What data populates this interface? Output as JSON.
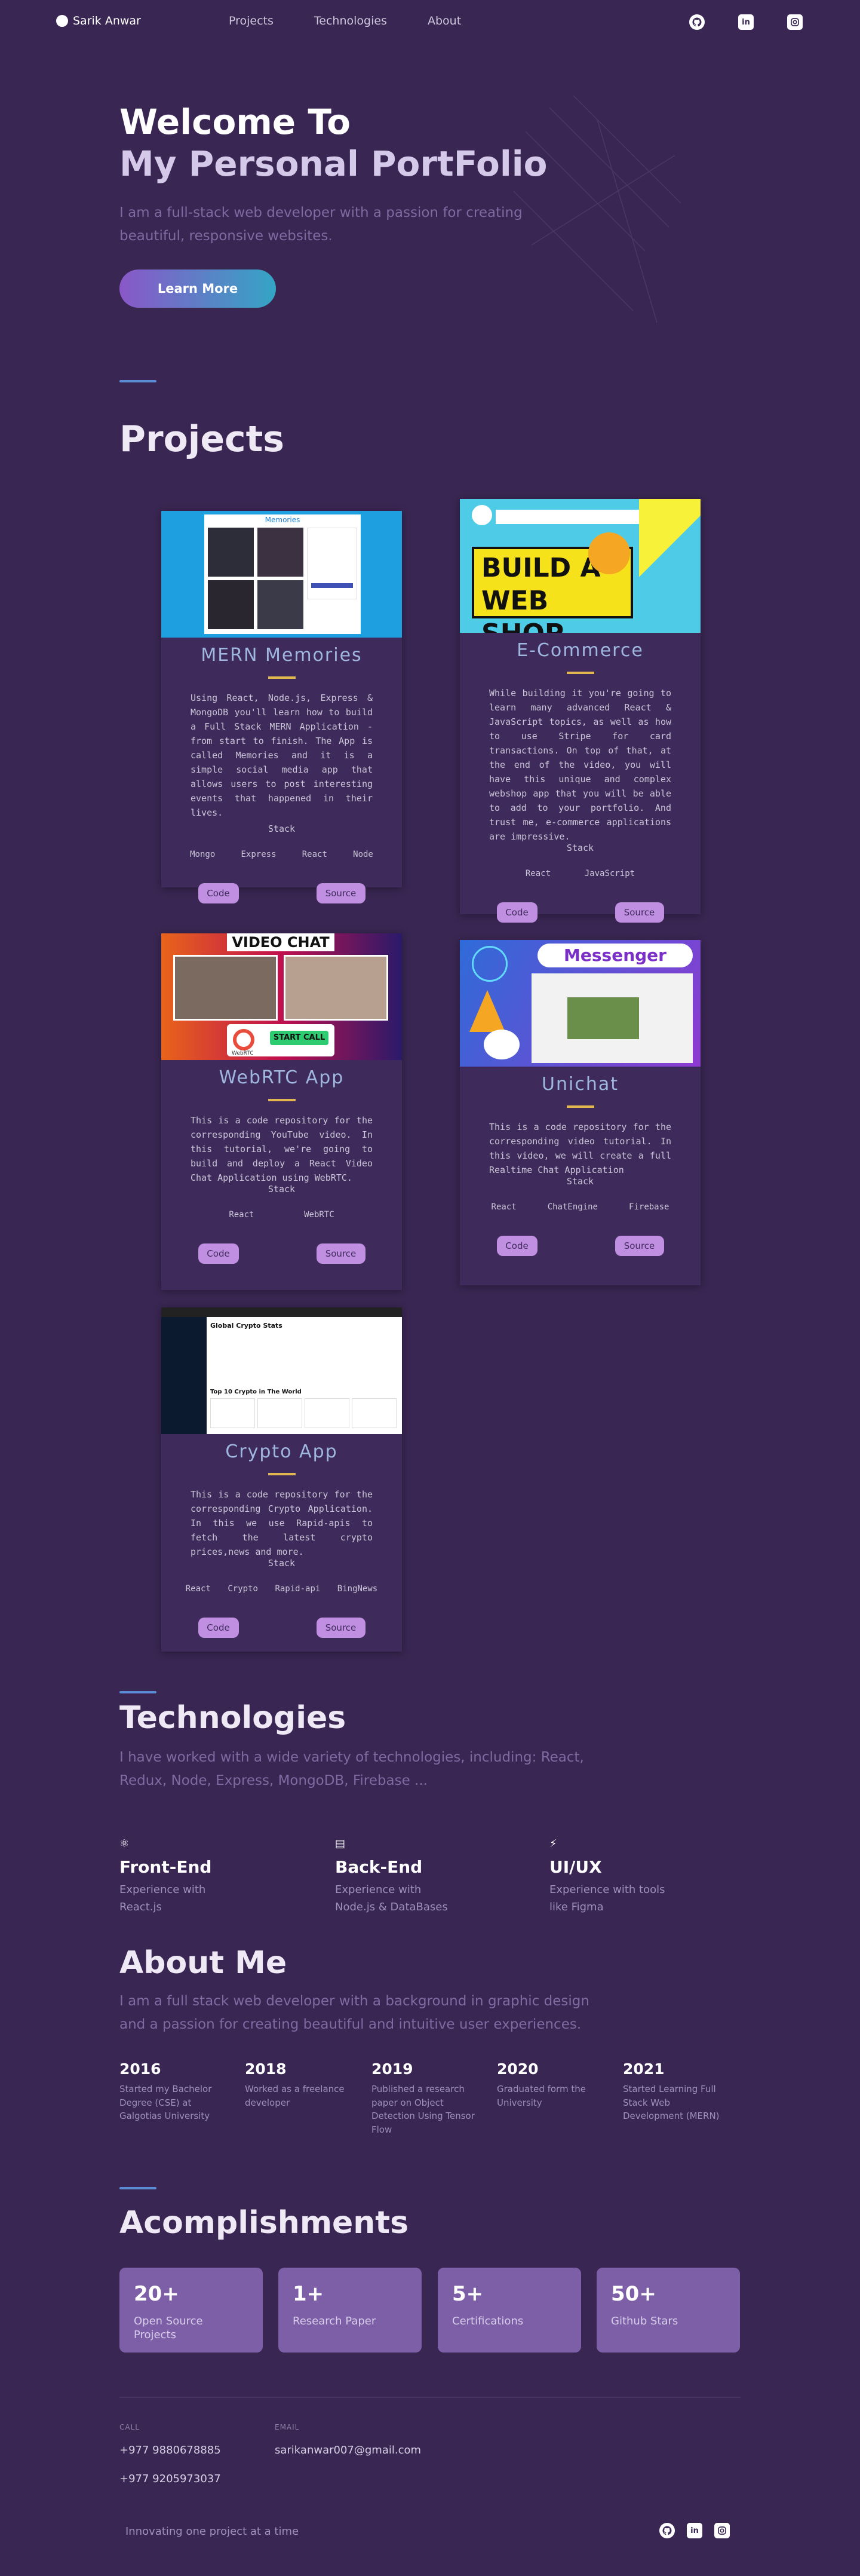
{
  "nav": {
    "brand": "Sarik Anwar",
    "links": [
      "Projects",
      "Technologies",
      "About"
    ],
    "social": [
      "github-icon",
      "linkedin-icon",
      "instagram-icon"
    ]
  },
  "hero": {
    "title_line1": "Welcome To",
    "title_line2": "My Personal PortFolio",
    "description": "I am a full-stack web developer with a passion for creating beautiful, responsive websites.",
    "button": "Learn More"
  },
  "projects": {
    "title": "Projects",
    "items": [
      {
        "title": "MERN Memories",
        "image_caption": "Memories",
        "description": "Using React, Node.js, Express & MongoDB you'll learn how to build a Full Stack MERN Application - from start to finish. The App is called Memories and it is a simple social media app that allows users to post interesting events that happened in their lives.",
        "stack_label": "Stack",
        "tags": [
          "Mongo",
          "Express",
          "React",
          "Node"
        ],
        "code": "Code",
        "source": "Source"
      },
      {
        "title": "E-Commerce",
        "image_caption_1": "BUILD A",
        "image_caption_2": "WEB SHOP",
        "description": "While building it you're going to learn many advanced React & JavaScript topics, as well as how to use Stripe for card transactions. On top of that, at the end of the video, you will have this unique and complex webshop app that you will be able to add to your portfolio. And trust me, e-commerce applications are impressive.",
        "stack_label": "Stack",
        "tags": [
          "React",
          "JavaScript"
        ],
        "code": "Code",
        "source": "Source"
      },
      {
        "title": "WebRTC App",
        "image_caption_1": "VIDEO CHAT",
        "image_caption_2": "START CALL",
        "image_caption_3": "WebRTC",
        "description": "This is a code repository for the corresponding YouTube video. In this tutorial, we're going to build and deploy a React Video Chat Application using WebRTC.",
        "stack_label": "Stack",
        "tags": [
          "React",
          "WebRTC"
        ],
        "code": "Code",
        "source": "Source"
      },
      {
        "title": "Unichat",
        "image_caption": "Messenger",
        "description": "This is a code repository for the corresponding video tutorial. In this video, we will create a full Realtime Chat Application",
        "stack_label": "Stack",
        "tags": [
          "React",
          "ChatEngine",
          "Firebase"
        ],
        "code": "Code",
        "source": "Source"
      },
      {
        "title": "Crypto App",
        "image_caption_1": "Global Crypto Stats",
        "image_caption_2": "Top 10 Crypto in The World",
        "description": "This is a code repository for the corresponding Crypto Application. In this we use Rapid-apis to fetch the latest crypto prices,news and more.",
        "stack_label": "Stack",
        "tags": [
          "React",
          "Crypto",
          "Rapid-api",
          "BingNews"
        ],
        "code": "Code",
        "source": "Source"
      }
    ]
  },
  "technologies": {
    "title": "Technologies",
    "description": "I have worked with a wide variety of technologies, including: React, Redux, Node, Express, MongoDB, Firebase ...",
    "items": [
      {
        "title": "Front-End",
        "desc": "Experience with React.js"
      },
      {
        "title": "Back-End",
        "desc": "Experience with Node.js & DataBases"
      },
      {
        "title": "UI/UX",
        "desc": "Experience with tools like Figma"
      }
    ]
  },
  "about": {
    "title": "About Me",
    "description": "I am a full stack web developer with a background in graphic design and a passion for creating beautiful and intuitive user experiences.",
    "timeline": [
      {
        "year": "2016",
        "event": "Started my Bachelor Degree (CSE) at Galgotias University"
      },
      {
        "year": "2018",
        "event": "Worked as a freelance developer"
      },
      {
        "year": "2019",
        "event": "Published a research paper on Object Detection Using Tensor Flow"
      },
      {
        "year": "2020",
        "event": "Graduated form the University"
      },
      {
        "year": "2021",
        "event": "Started Learning Full Stack Web Development (MERN)"
      }
    ]
  },
  "accomplishments": {
    "title": "Acomplishments",
    "items": [
      {
        "number": "20+",
        "label": "Open Source Projects"
      },
      {
        "number": "1+",
        "label": "Research Paper"
      },
      {
        "number": "5+",
        "label": "Certifications"
      },
      {
        "number": "50+",
        "label": "Github Stars"
      }
    ]
  },
  "footer": {
    "call_label": "CALL",
    "phone1": "+977 9880678885",
    "phone2": "+977 9205973037",
    "email_label": "EMAIL",
    "email": "sarikanwar007@gmail.com",
    "motto": "Innovating one project at a time"
  }
}
